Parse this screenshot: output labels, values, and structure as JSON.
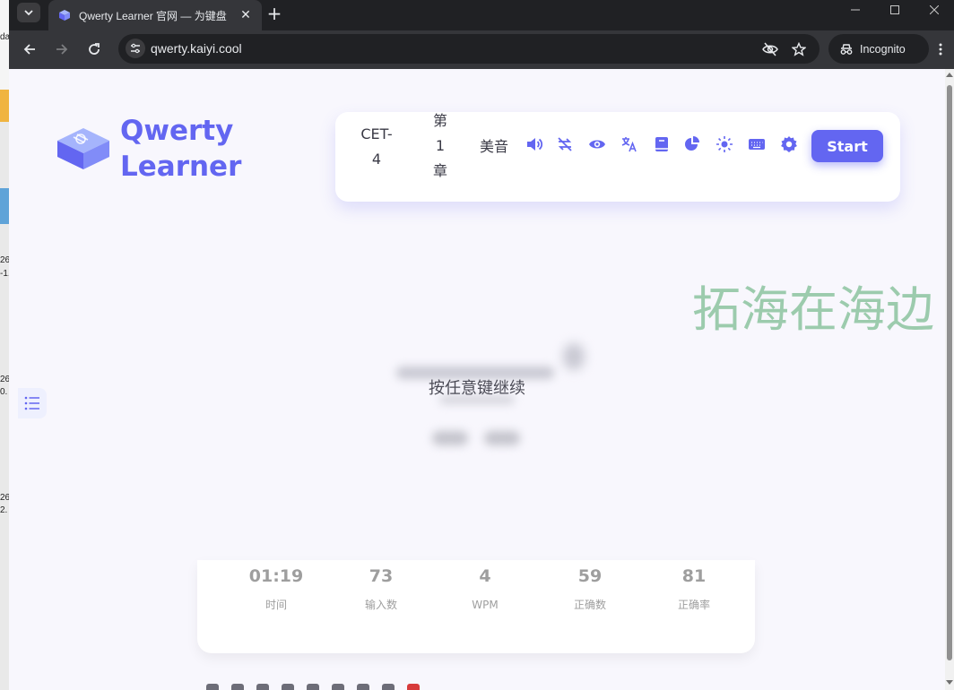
{
  "browser": {
    "tab_title": "Qwerty Learner 官网 — 为键盘",
    "tab_close_glyph": "✕",
    "new_tab_glyph": "+",
    "url": "qwerty.kaiyi.cool",
    "incognito_label": "Incognito",
    "colors": {
      "frame": "#202124",
      "toolbar": "#35363a",
      "text": "#e8eaed"
    }
  },
  "left_strip": {
    "texts": [
      "da",
      "26",
      "-1.",
      "26",
      "0.",
      "26",
      "2."
    ]
  },
  "logo": {
    "line1": "Qwerty",
    "line2": "Learner",
    "color": "#6366f1"
  },
  "menu": {
    "dictionary_line1": "CET-",
    "dictionary_line2": "4",
    "chapter_line1": "第",
    "chapter_line2": "1",
    "chapter_line3": "章",
    "pronunciation": "美音",
    "icons": [
      "volume-icon",
      "loop-icon",
      "eye-icon",
      "translate-icon",
      "book-icon",
      "pie-chart-icon",
      "sun-icon",
      "keyboard-icon",
      "gear-icon"
    ],
    "start_label": "Start",
    "accent": "#6366f1"
  },
  "watermark": "拓海在海边",
  "word_area": {
    "continue_hint": "按任意键继续"
  },
  "stats": [
    {
      "value": "01:19",
      "label": "时间"
    },
    {
      "value": "73",
      "label": "输入数"
    },
    {
      "value": "4",
      "label": "WPM"
    },
    {
      "value": "59",
      "label": "正确数"
    },
    {
      "value": "81",
      "label": "正确率"
    }
  ]
}
